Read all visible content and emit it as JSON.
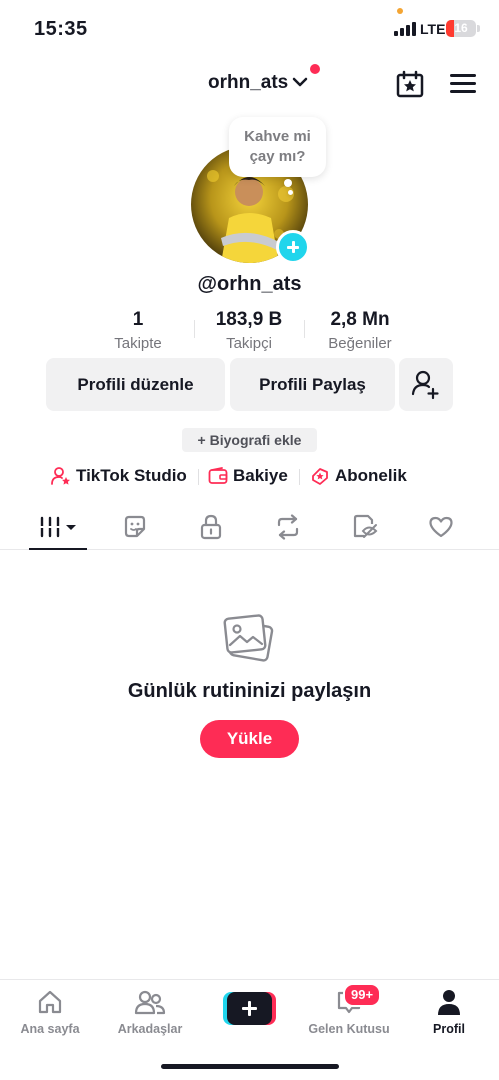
{
  "status_bar": {
    "time": "15:35",
    "network": "LTE",
    "battery": "16",
    "battery_level": 0.16
  },
  "header": {
    "username": "orhn_ats",
    "has_notification": true
  },
  "profile": {
    "bubble_text_line1": "Kahve mi",
    "bubble_text_line2": "çay mı?",
    "handle": "@orhn_ats",
    "stats": [
      {
        "value": "1",
        "label": "Takipte"
      },
      {
        "value": "183,9 B",
        "label": "Takipçi"
      },
      {
        "value": "2,8 Mn",
        "label": "Beğeniler"
      }
    ],
    "edit_button": "Profili düzenle",
    "share_button": "Profili Paylaş",
    "bio_button": "+ Biyografi ekle"
  },
  "links": [
    {
      "label": "TikTok Studio",
      "icon": "person-star-icon"
    },
    {
      "label": "Bakiye",
      "icon": "wallet-icon"
    },
    {
      "label": "Abonelik",
      "icon": "subscription-icon"
    }
  ],
  "tabs": [
    {
      "name": "videos-grid",
      "icon": "grid-bars-icon",
      "active": true
    },
    {
      "name": "stickers",
      "icon": "sticker-icon"
    },
    {
      "name": "private",
      "icon": "lock-icon"
    },
    {
      "name": "reposts",
      "icon": "repost-icon"
    },
    {
      "name": "hidden",
      "icon": "hidden-eye-icon"
    },
    {
      "name": "liked",
      "icon": "heart-icon"
    }
  ],
  "empty_state": {
    "title": "Günlük rutininizi paylaşın",
    "button": "Yükle",
    "icon": "photos-icon"
  },
  "bottom_nav": [
    {
      "label": "Ana sayfa",
      "icon": "home-icon"
    },
    {
      "label": "Arkadaşlar",
      "icon": "friends-icon"
    },
    {
      "label": "",
      "icon": "create-plus-icon"
    },
    {
      "label": "Gelen Kutusu",
      "icon": "inbox-icon",
      "badge": "99+"
    },
    {
      "label": "Profil",
      "icon": "profile-icon",
      "active": true
    }
  ],
  "colors": {
    "accent": "#fe2c55",
    "cyan": "#20d5ec",
    "text": "#161823",
    "muted": "#75757b"
  }
}
